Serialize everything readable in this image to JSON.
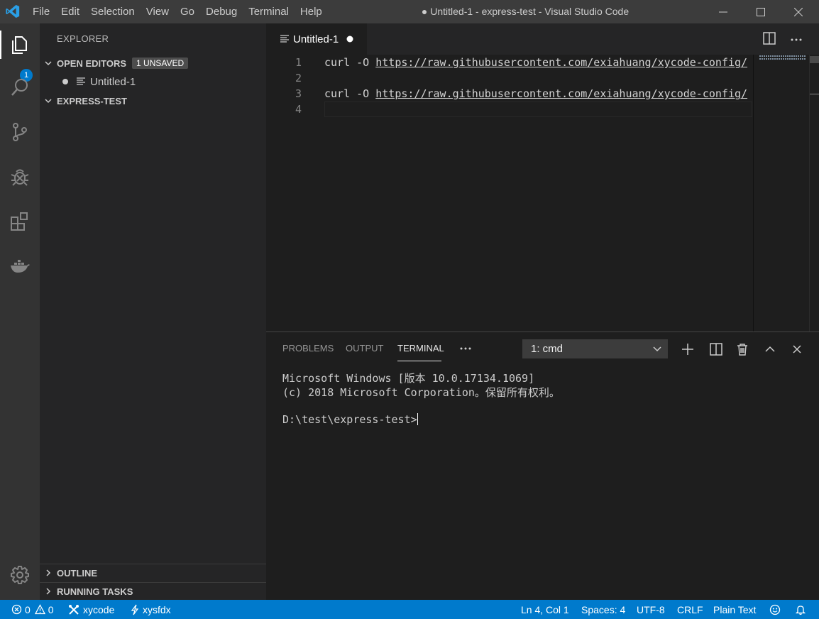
{
  "window": {
    "title": "● Untitled-1 - express-test - Visual Studio Code",
    "menu": [
      "File",
      "Edit",
      "Selection",
      "View",
      "Go",
      "Debug",
      "Terminal",
      "Help"
    ]
  },
  "activity_bar": {
    "explorer_badge": "1"
  },
  "sidebar": {
    "title": "EXPLORER",
    "open_editors": {
      "label": "OPEN EDITORS",
      "badge": "1 UNSAVED",
      "files": [
        "Untitled-1"
      ]
    },
    "workspace": "EXPRESS-TEST",
    "outline": "OUTLINE",
    "running_tasks": "RUNNING TASKS"
  },
  "editor": {
    "tab_label": "Untitled-1",
    "lines": [
      {
        "num": "1",
        "cmd": "curl -O ",
        "url": "https://raw.githubusercontent.com/exiahuang/xycode-config/"
      },
      {
        "num": "2",
        "cmd": "",
        "url": ""
      },
      {
        "num": "3",
        "cmd": "curl -O ",
        "url": "https://raw.githubusercontent.com/exiahuang/xycode-config/"
      },
      {
        "num": "4",
        "cmd": "",
        "url": ""
      }
    ]
  },
  "panel": {
    "tabs": [
      "PROBLEMS",
      "OUTPUT",
      "TERMINAL"
    ],
    "active_tab": "TERMINAL",
    "terminal_select": "1: cmd",
    "terminal_lines": [
      "Microsoft Windows [版本 10.0.17134.1069]",
      "(c) 2018 Microsoft Corporation。保留所有权利。",
      "",
      "D:\\test\\express-test>"
    ]
  },
  "status_bar": {
    "errors": "0",
    "warnings": "0",
    "xycode": "xycode",
    "xysfdx": "xysfdx",
    "position": "Ln 4, Col 1",
    "spaces": "Spaces: 4",
    "encoding": "UTF-8",
    "eol": "CRLF",
    "language": "Plain Text"
  },
  "colors": {
    "accent": "#007acc",
    "titlebar": "#3c3c3c",
    "activity_bar": "#333333",
    "sidebar": "#252526",
    "editor": "#1e1e1e"
  }
}
